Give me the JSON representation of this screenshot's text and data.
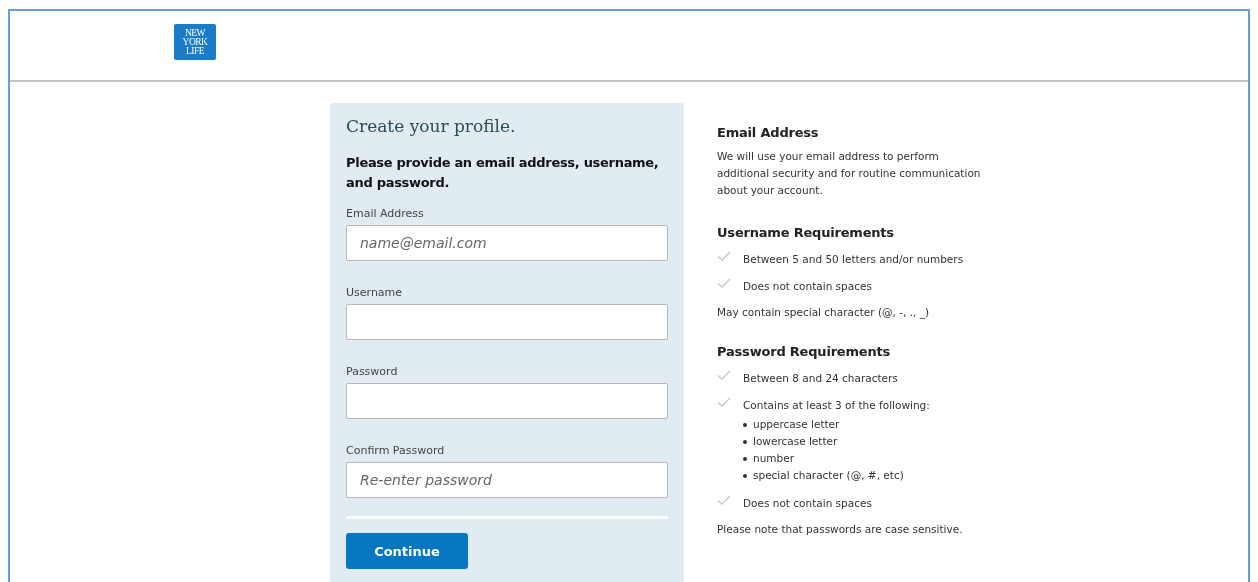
{
  "logo": {
    "lines": [
      "NEW",
      "YORK",
      "LIFE"
    ]
  },
  "form": {
    "title": "Create your profile.",
    "intro": "Please provide an email address, username, and password.",
    "fields": [
      {
        "label": "Email Address",
        "placeholder": "name@email.com"
      },
      {
        "label": "Username"
      },
      {
        "label": "Password"
      },
      {
        "label": "Confirm Password",
        "placeholder": "Re-enter password"
      }
    ],
    "button": "Continue"
  },
  "info": {
    "sections": [
      {
        "heading": "Email Address",
        "text": "We will use your email address to perform additional security and for routine communication about your account."
      },
      {
        "heading": "Username Requirements",
        "checks": [
          {
            "text": "Between 5 and 50 letters and/or numbers",
            "met": false
          },
          {
            "text": "Does not contain spaces",
            "met": false
          }
        ],
        "note": "May contain special character (@, -, ., _)"
      },
      {
        "heading": "Password Requirements",
        "checks": [
          {
            "text": "Between 8 and 24 characters",
            "met": false
          },
          {
            "text": "Contains at least 3 of the following:",
            "met": false,
            "bullets": [
              "uppercase letter",
              "lowercase letter",
              "number",
              "special character (@, #, etc)"
            ]
          },
          {
            "text": "Does not contain spaces",
            "met": false
          }
        ],
        "note": "Please note that passwords are case sensitive."
      }
    ]
  }
}
